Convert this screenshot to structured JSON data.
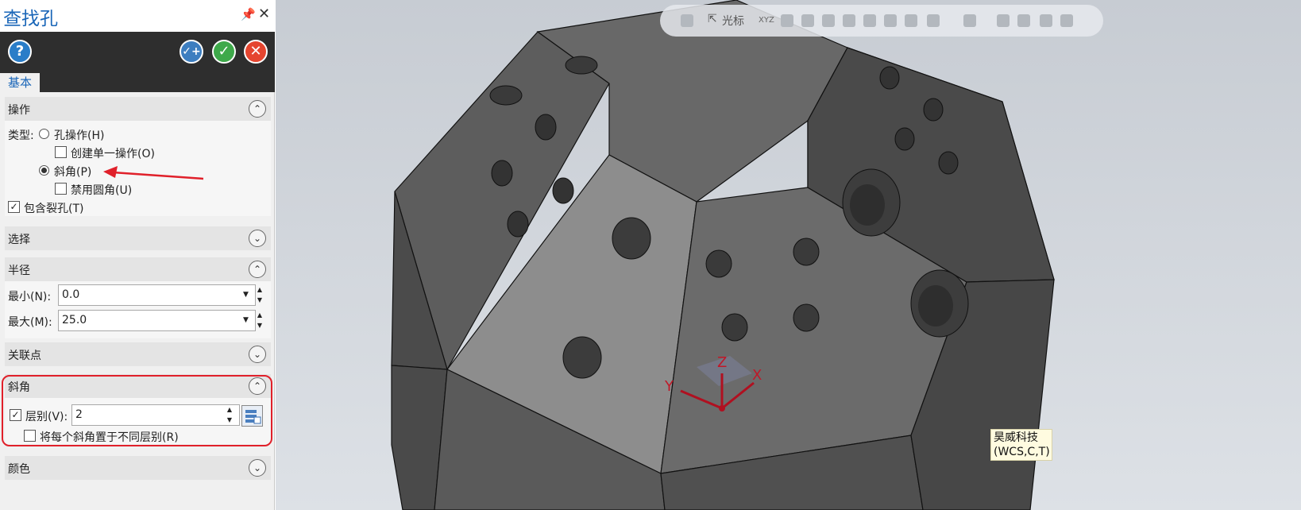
{
  "panel": {
    "title": "查找孔",
    "tab": "基本",
    "toolbar": {
      "help": "?",
      "apply": "✓+",
      "ok": "✓",
      "cancel": "✕"
    },
    "sections": {
      "operation": {
        "header": "操作",
        "type_label": "类型:",
        "option_hole": "孔操作(H)",
        "option_single": "创建单一操作(O)",
        "option_bevel": "斜角(P)",
        "option_disable_fillet": "禁用圆角(U)",
        "option_include_split": "包含裂孔(T)"
      },
      "select": {
        "header": "选择"
      },
      "radius": {
        "header": "半径",
        "min_label": "最小(N):",
        "min_value": "0.0",
        "max_label": "最大(M):",
        "max_value": "25.0"
      },
      "association": {
        "header": "关联点"
      },
      "bevel": {
        "header": "斜角",
        "layer_label": "层别(V):",
        "layer_value": "2",
        "each_layer_label": "将每个斜角置于不同层别(R)"
      },
      "color": {
        "header": "颜色"
      }
    }
  },
  "viewport": {
    "toolbar_label": "光标",
    "toolbar_xyz": "XYZ",
    "axis_x": "X",
    "axis_y": "Y",
    "axis_z": "Z",
    "tooltip_line1": "昊威科技",
    "tooltip_line2": "(WCS,C,T)"
  },
  "colors": {
    "accent": "#1a66b8",
    "highlight": "#e0202a",
    "arrow": "#e0202a"
  }
}
